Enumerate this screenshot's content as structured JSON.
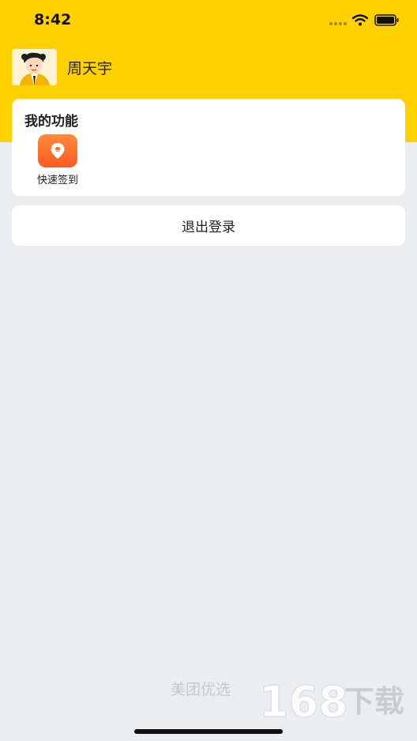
{
  "status_bar": {
    "time": "8:42"
  },
  "profile": {
    "name": "周天宇"
  },
  "functions": {
    "title": "我的功能",
    "items": [
      {
        "label": "快速签到",
        "icon": "location-pin-icon"
      }
    ]
  },
  "logout": {
    "label": "退出登录"
  },
  "footer": {
    "brand": "美团优选",
    "watermark": "168下载"
  },
  "colors": {
    "header": "#FFD100",
    "background": "#EBEEF1",
    "accent": "#FF6A2A"
  }
}
